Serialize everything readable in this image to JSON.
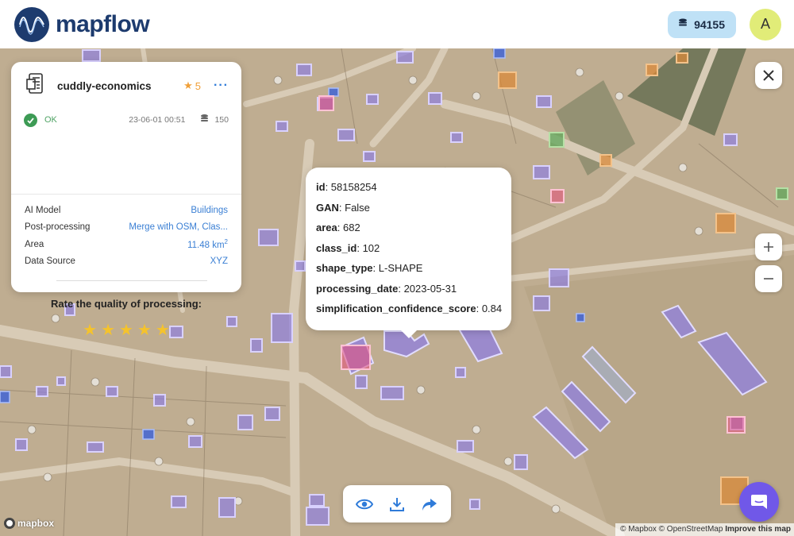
{
  "header": {
    "brand": "mapflow",
    "credits": "94155",
    "avatar_initial": "A",
    "icons": {
      "logo": "mapflow-wave-logo",
      "credits": "coins-icon"
    }
  },
  "project": {
    "name": "cuddly-economics",
    "rating": "5",
    "status": "OK",
    "date": "23-06-01 00:51",
    "files_count": "150",
    "details": [
      {
        "key": "AI Model",
        "value": "Buildings"
      },
      {
        "key": "Post-processing",
        "value": "Merge with OSM, Clas..."
      },
      {
        "key": "Area",
        "value": "11.48 km",
        "unit_sup": "2"
      },
      {
        "key": "Data Source",
        "value": "XYZ"
      }
    ],
    "rate_prompt": "Rate the quality of processing:",
    "stars": 5
  },
  "feature": {
    "attributes": [
      {
        "key": "id",
        "value": "58158254"
      },
      {
        "key": "GAN",
        "value": "False"
      },
      {
        "key": "area",
        "value": "682"
      },
      {
        "key": "class_id",
        "value": "102"
      },
      {
        "key": "shape_type",
        "value": "L-SHAPE"
      },
      {
        "key": "processing_date",
        "value": "2023-05-31"
      },
      {
        "key": "simplification_confidence_score",
        "value": "0.84"
      }
    ]
  },
  "map": {
    "attribution": "© Mapbox © OpenStreetMap",
    "improve": "Improve this map",
    "logo": "mapbox",
    "controls": [
      "close-icon",
      "zoom-in-icon",
      "zoom-out-icon"
    ],
    "toolbar": [
      "eye-icon",
      "download-icon",
      "share-arrow-icon"
    ],
    "colors": {
      "building": "#8f7fe0",
      "building_edge": "#c6bdfa",
      "ok": "#3d9b55",
      "link": "#3a7fd4",
      "rating": "#f0a039"
    }
  }
}
